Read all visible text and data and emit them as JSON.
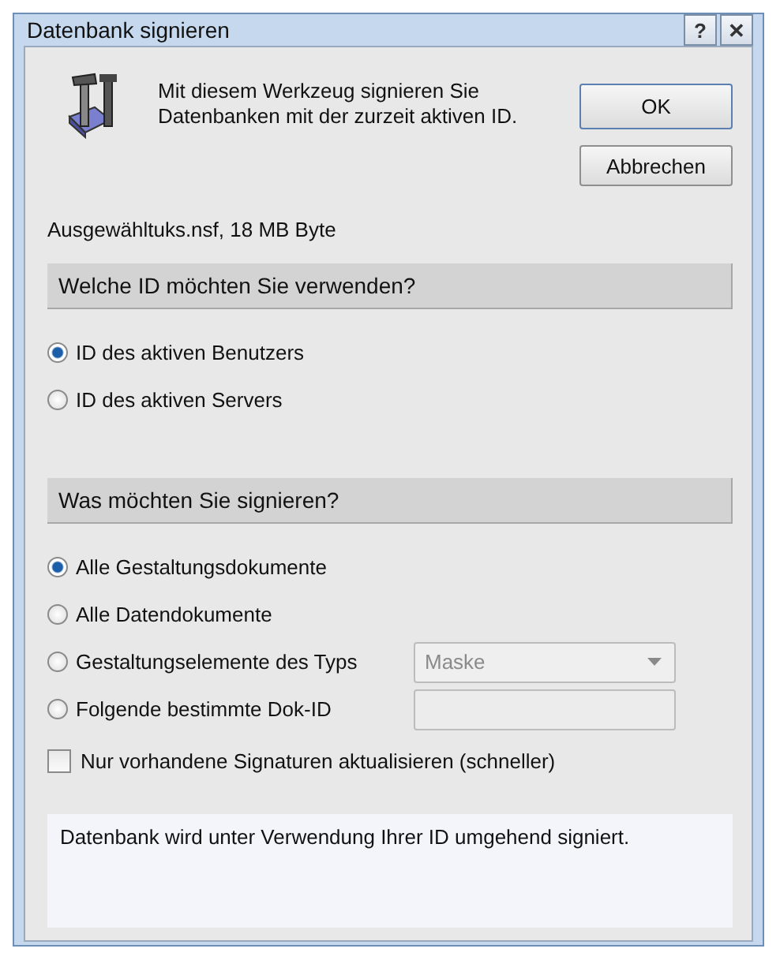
{
  "window": {
    "title": "Datenbank signieren",
    "buttons": [
      "?",
      "✕"
    ]
  },
  "intro": "Mit diesem Werkzeug signieren Sie Datenbanken mit der zurzeit aktiven ID.",
  "actions": [
    "OK",
    "Abbrechen"
  ],
  "file_info": "Ausgewähltuks.nsf, 18 MB Byte",
  "sections": [
    {
      "header": "Welche ID möchten Sie verwenden?",
      "options": [
        {
          "label": "ID des aktiven Benutzers",
          "selected": true
        },
        {
          "label": "ID des aktiven Servers",
          "selected": false
        }
      ]
    },
    {
      "header": "Was möchten Sie signieren?",
      "options": [
        {
          "label": "Alle Gestaltungsdokumente",
          "selected": true
        },
        {
          "label": "Alle Datendokumente",
          "selected": false
        },
        {
          "label": "Gestaltungselemente des Typs",
          "selected": false,
          "extra": {
            "kind": "dropdown",
            "value": "Maske",
            "disabled": true
          }
        },
        {
          "label": "Folgende bestimmte Dok-ID",
          "selected": false,
          "extra": {
            "kind": "field",
            "disabled": true
          }
        }
      ]
    }
  ],
  "update_only": {
    "label": "Nur vorhandene Signaturen aktualisieren (schneller)",
    "checked": false
  },
  "info": "Datenbank wird unter Verwendung Ihrer ID umgehend signiert."
}
